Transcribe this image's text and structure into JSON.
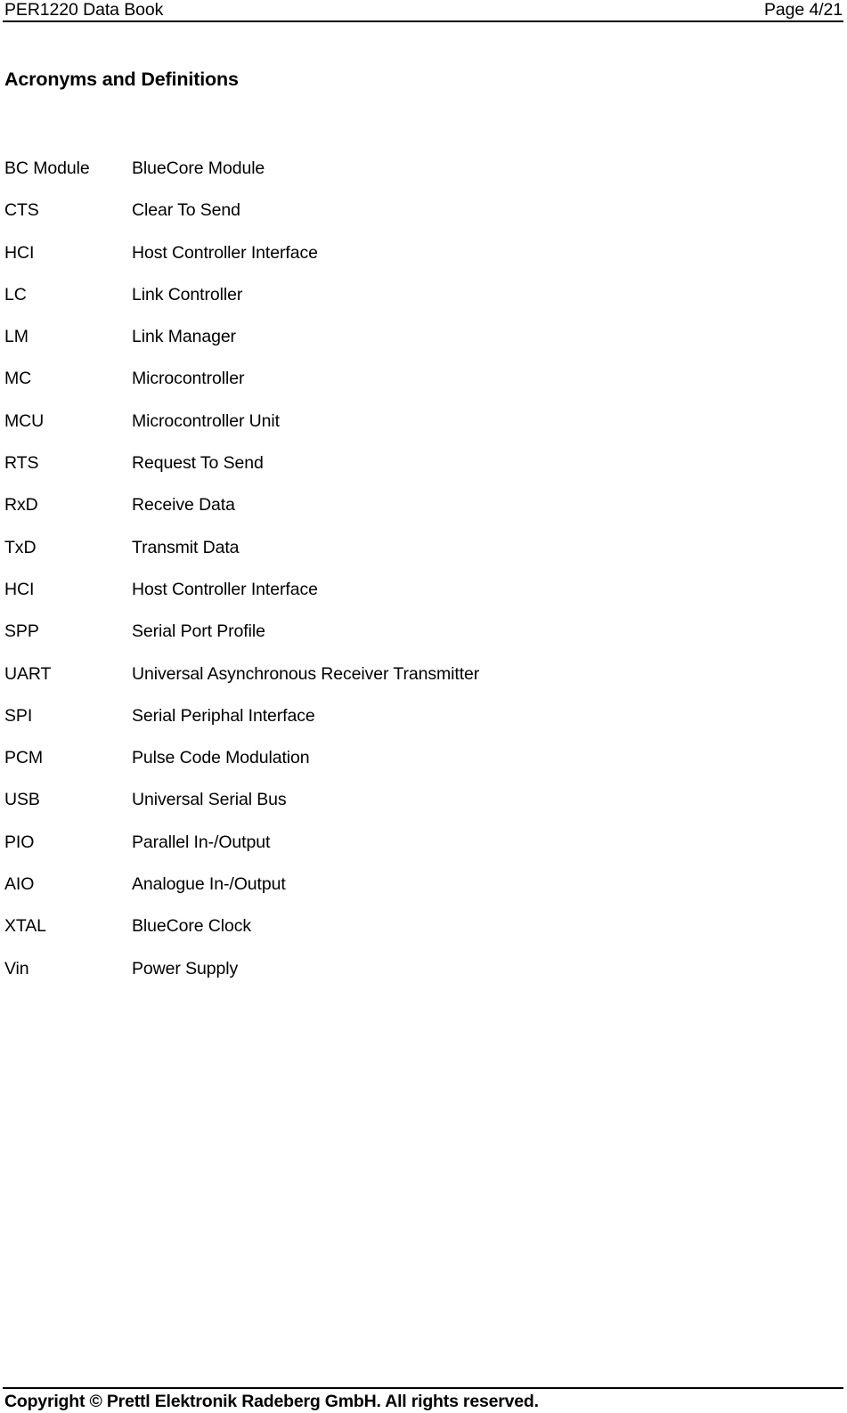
{
  "header": {
    "document_title": "PER1220 Data Book",
    "page_label": "Page 4/21"
  },
  "title": "Acronyms and Definitions",
  "acronyms": [
    {
      "term": "BC Module",
      "definition": "BlueCore Module"
    },
    {
      "term": "CTS",
      "definition": "Clear To Send"
    },
    {
      "term": "HCI",
      "definition": "Host Controller Interface"
    },
    {
      "term": "LC",
      "definition": "Link Controller"
    },
    {
      "term": "LM",
      "definition": "Link Manager"
    },
    {
      "term": "MC",
      "definition": "Microcontroller"
    },
    {
      "term": "MCU",
      "definition": "Microcontroller Unit"
    },
    {
      "term": "RTS",
      "definition": "Request To Send"
    },
    {
      "term": "RxD",
      "definition": "Receive Data"
    },
    {
      "term": "TxD",
      "definition": "Transmit Data"
    },
    {
      "term": "HCI",
      "definition": "Host Controller Interface"
    },
    {
      "term": "SPP",
      "definition": "Serial Port Profile"
    },
    {
      "term": "UART",
      "definition": "Universal Asynchronous Receiver Transmitter"
    },
    {
      "term": "SPI",
      "definition": "Serial Periphal Interface"
    },
    {
      "term": "PCM",
      "definition": "Pulse Code Modulation"
    },
    {
      "term": "USB",
      "definition": "Universal Serial Bus"
    },
    {
      "term": "PIO",
      "definition": "Parallel In-/Output"
    },
    {
      "term": "AIO",
      "definition": "Analogue In-/Output"
    },
    {
      "term": "XTAL",
      "definition": "BlueCore Clock"
    },
    {
      "term": "Vin",
      "definition": "Power Supply"
    }
  ],
  "footer": {
    "copyright": "Copyright © Prettl Elektronik Radeberg GmbH. All rights reserved."
  },
  "colors": {
    "text": "#000000",
    "background": "#ffffff",
    "rule": "#000000"
  }
}
